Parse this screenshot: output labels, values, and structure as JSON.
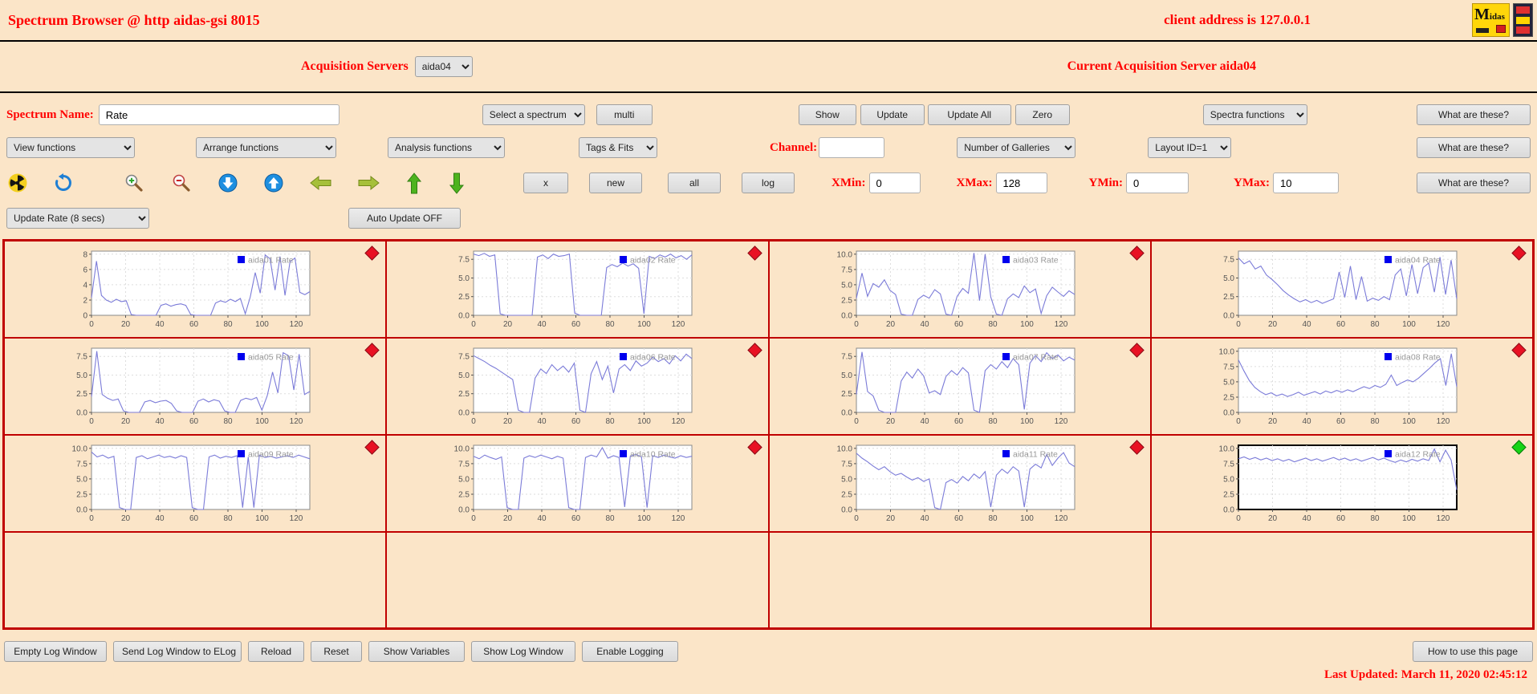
{
  "header": {
    "title": "Spectrum Browser @ http aidas-gsi 8015",
    "client_address": "client address is 127.0.0.1",
    "midas_logo_m": "M",
    "midas_logo_rest": "idas"
  },
  "server_bar": {
    "label": "Acquisition Servers",
    "server_select": "aida04",
    "current_server": "Current Acquisition Server aida04"
  },
  "spectrum_bar": {
    "name_label": "Spectrum Name:",
    "name_value": "Rate",
    "spectrum_select": "Select a spectrum",
    "multi_button": "multi",
    "show_button": "Show",
    "update_button": "Update",
    "update_all_button": "Update All",
    "zero_button": "Zero",
    "spectra_functions_select": "Spectra functions",
    "help_button": "What are these?"
  },
  "functions_bar": {
    "view_select": "View functions",
    "arrange_select": "Arrange functions",
    "analysis_select": "Analysis functions",
    "tags_select": "Tags & Fits",
    "channel_label": "Channel:",
    "channel_value": "",
    "galleries_select": "Number of Galleries",
    "layout_select": "Layout ID=1",
    "help_button": "What are these?"
  },
  "zoom_bar": {
    "icons": [
      "radiation-icon",
      "refresh-icon",
      "zoom-in-icon",
      "zoom-out-icon",
      "scale-down-icon",
      "scale-up-icon",
      "pan-left-icon",
      "pan-right-icon",
      "pan-up-icon",
      "pan-down-icon"
    ],
    "x_button": "x",
    "new_button": "new",
    "all_button": "all",
    "log_button": "log",
    "xmin_label": "XMin:",
    "xmin_value": "0",
    "xmax_label": "XMax:",
    "xmax_value": "128",
    "ymin_label": "YMin:",
    "ymin_value": "0",
    "ymax_label": "YMax:",
    "ymax_value": "10",
    "help_button": "What are these?"
  },
  "update_bar": {
    "rate_select": "Update Rate (8 secs)",
    "auto_update_button": "Auto Update OFF"
  },
  "footer": {
    "buttons": [
      "Empty Log Window",
      "Send Log Window to ELog",
      "Reload",
      "Reset",
      "Show Variables",
      "Show Log Window",
      "Enable Logging"
    ],
    "help_button": "How to use this page",
    "last_updated": "Last Updated: March 11, 2020 02:45:12"
  },
  "chart_data": {
    "type": "line",
    "x_range": [
      0,
      128
    ],
    "xticks": [
      0,
      20,
      40,
      60,
      80,
      100,
      120
    ],
    "grid": true,
    "legend_position": "top-right",
    "line_color": "#7b7bd8",
    "legend_marker_color": "#0000ee",
    "empty_cells": 4,
    "panels": [
      {
        "name": "aida01 Rate",
        "marker": "red",
        "selected": false,
        "ymax": 8.4,
        "yticks": [
          0,
          2,
          4,
          6,
          8
        ],
        "ytick_labels": [
          "0",
          "2",
          "4",
          "6",
          "8"
        ],
        "values": [
          2.3,
          7.1,
          2.6,
          2.0,
          1.7,
          2.1,
          1.8,
          1.9,
          0.1,
          0,
          0,
          0,
          0,
          0,
          1.3,
          1.5,
          1.2,
          1.4,
          1.5,
          1.3,
          0.1,
          0,
          0,
          0,
          0,
          1.6,
          1.9,
          1.7,
          2.1,
          1.8,
          2.2,
          0.2,
          2.4,
          5.6,
          2.9,
          7.9,
          7.4,
          3.3,
          7.7,
          2.6,
          7.0,
          7.5,
          3.0,
          2.7,
          3.1
        ]
      },
      {
        "name": "aida02 Rate",
        "marker": "red",
        "selected": false,
        "ymax": 8.6,
        "yticks": [
          0,
          2.5,
          5,
          7.5
        ],
        "ytick_labels": [
          "0.0",
          "2.5",
          "5.0",
          "7.5"
        ],
        "values": [
          8.2,
          8.0,
          8.3,
          7.9,
          8.1,
          0.2,
          0,
          0,
          0,
          0,
          0,
          0,
          7.8,
          8.1,
          7.6,
          8.2,
          7.9,
          8.0,
          8.2,
          0.3,
          0,
          0,
          0,
          0,
          0,
          6.4,
          6.8,
          6.5,
          7.0,
          6.6,
          6.9,
          6.3,
          0.2,
          7.9,
          7.6,
          8.1,
          7.8,
          8.2,
          7.7,
          8.0,
          7.5,
          8.1
        ]
      },
      {
        "name": "aida03 Rate",
        "marker": "red",
        "selected": false,
        "ymax": 10.5,
        "yticks": [
          0,
          2.5,
          5,
          7.5,
          10
        ],
        "ytick_labels": [
          "0.0",
          "2.5",
          "5.0",
          "7.5",
          "10.0"
        ],
        "values": [
          2.8,
          6.9,
          3.1,
          5.2,
          4.6,
          5.8,
          4.1,
          3.4,
          0.2,
          0,
          0,
          2.6,
          3.3,
          2.8,
          4.2,
          3.5,
          0.2,
          0,
          3.1,
          4.4,
          3.6,
          10.2,
          2.4,
          10.0,
          3.0,
          0.2,
          0,
          2.7,
          3.5,
          2.9,
          4.8,
          3.7,
          4.3,
          0.3,
          3.2,
          4.6,
          3.8,
          3.1,
          4.0,
          3.4
        ]
      },
      {
        "name": "aida04 Rate",
        "marker": "red",
        "selected": false,
        "ymax": 8.6,
        "yticks": [
          0,
          2.5,
          5,
          7.5
        ],
        "ytick_labels": [
          "0.0",
          "2.5",
          "5.0",
          "7.5"
        ],
        "values": [
          7.7,
          6.9,
          7.3,
          6.2,
          6.6,
          5.4,
          4.8,
          4.1,
          3.3,
          2.7,
          2.2,
          1.8,
          2.1,
          1.7,
          2.0,
          1.6,
          1.9,
          2.2,
          5.8,
          2.4,
          6.6,
          2.1,
          5.2,
          1.9,
          2.3,
          2.0,
          2.5,
          2.1,
          5.4,
          6.2,
          2.6,
          6.8,
          2.9,
          6.4,
          7.0,
          3.1,
          7.8,
          2.8,
          7.4,
          2.2
        ]
      },
      {
        "name": "aida05 Rate",
        "marker": "red",
        "selected": false,
        "ymax": 8.6,
        "yticks": [
          0,
          2.5,
          5,
          7.5
        ],
        "ytick_labels": [
          "0.0",
          "2.5",
          "5.0",
          "7.5"
        ],
        "values": [
          2.1,
          8.2,
          2.4,
          1.9,
          1.6,
          1.8,
          0.2,
          0,
          0,
          0,
          1.4,
          1.6,
          1.3,
          1.5,
          1.6,
          1.2,
          0.2,
          0,
          0,
          0,
          1.5,
          1.8,
          1.4,
          1.7,
          1.5,
          0.2,
          0,
          0,
          1.6,
          1.9,
          1.7,
          2.0,
          0.3,
          2.2,
          5.4,
          2.6,
          8.0,
          7.6,
          3.0,
          7.8,
          2.4,
          2.8
        ]
      },
      {
        "name": "aida06 Rate",
        "marker": "red",
        "selected": false,
        "ymax": 8.6,
        "yticks": [
          0,
          2.5,
          5,
          7.5
        ],
        "ytick_labels": [
          "0.0",
          "2.5",
          "5.0",
          "7.5"
        ],
        "values": [
          7.6,
          7.2,
          6.8,
          6.3,
          5.9,
          5.4,
          4.9,
          4.4,
          0.3,
          0,
          0,
          4.6,
          5.8,
          5.2,
          6.4,
          5.6,
          6.2,
          5.4,
          6.6,
          0.3,
          0,
          5.2,
          6.8,
          4.4,
          6.2,
          2.6,
          5.8,
          6.4,
          5.6,
          6.9,
          6.2,
          6.6,
          7.4,
          6.8,
          7.2,
          6.5,
          7.6,
          6.9,
          7.8,
          7.2
        ]
      },
      {
        "name": "aida07 Rate",
        "marker": "red",
        "selected": false,
        "ymax": 8.6,
        "yticks": [
          0,
          2.5,
          5,
          7.5
        ],
        "ytick_labels": [
          "0.0",
          "2.5",
          "5.0",
          "7.5"
        ],
        "values": [
          2.4,
          8.1,
          2.8,
          2.2,
          0.3,
          0,
          0,
          0,
          4.2,
          5.4,
          4.6,
          5.8,
          4.9,
          2.6,
          2.9,
          2.4,
          4.8,
          5.6,
          5.0,
          6.0,
          5.3,
          0.3,
          0,
          5.6,
          6.4,
          5.8,
          6.8,
          6.0,
          7.2,
          6.4,
          0.4,
          6.6,
          7.6,
          6.8,
          8.0,
          7.2,
          7.7,
          6.9,
          7.4,
          7.0
        ]
      },
      {
        "name": "aida08 Rate",
        "marker": "red",
        "selected": false,
        "ymax": 10.5,
        "yticks": [
          0,
          2.5,
          5,
          7.5,
          10
        ],
        "ytick_labels": [
          "0.0",
          "2.5",
          "5.0",
          "7.5",
          "10.0"
        ],
        "values": [
          8.6,
          6.8,
          5.2,
          4.1,
          3.4,
          2.9,
          3.2,
          2.7,
          3.0,
          2.6,
          2.9,
          3.3,
          2.8,
          3.1,
          3.4,
          3.0,
          3.5,
          3.2,
          3.6,
          3.3,
          3.7,
          3.4,
          3.8,
          4.2,
          3.9,
          4.4,
          4.1,
          4.6,
          6.1,
          4.4,
          4.9,
          5.3,
          5.0,
          5.6,
          6.4,
          7.2,
          8.1,
          8.8,
          4.4,
          9.6,
          4.2
        ]
      },
      {
        "name": "aida09 Rate",
        "marker": "red",
        "selected": false,
        "ymax": 10.5,
        "yticks": [
          0,
          2.5,
          5,
          7.5,
          10
        ],
        "ytick_labels": [
          "0.0",
          "2.5",
          "5.0",
          "7.5",
          "10.0"
        ],
        "values": [
          9.4,
          8.6,
          8.9,
          8.4,
          8.7,
          0.3,
          0,
          0,
          8.5,
          8.8,
          8.3,
          8.6,
          8.9,
          8.5,
          8.7,
          8.4,
          8.8,
          8.5,
          0.3,
          0,
          0,
          8.6,
          8.9,
          8.4,
          8.7,
          8.5,
          8.8,
          0.3,
          8.6,
          0.3,
          8.9,
          8.5,
          8.7,
          8.4,
          8.6,
          8.8,
          8.5,
          8.9,
          8.6,
          8.3
        ]
      },
      {
        "name": "aida10 Rate",
        "marker": "red",
        "selected": false,
        "ymax": 10.5,
        "yticks": [
          0,
          2.5,
          5,
          7.5,
          10
        ],
        "ytick_labels": [
          "0.0",
          "2.5",
          "5.0",
          "7.5",
          "10.0"
        ],
        "values": [
          8.7,
          8.3,
          8.9,
          8.5,
          8.2,
          8.6,
          0.3,
          0,
          0,
          8.4,
          8.8,
          8.5,
          8.9,
          8.6,
          8.3,
          8.7,
          8.4,
          0.3,
          0,
          0,
          8.5,
          8.9,
          8.6,
          10.1,
          8.4,
          8.8,
          8.5,
          0.4,
          8.7,
          9.0,
          8.6,
          0.3,
          8.8,
          8.5,
          8.9,
          8.6,
          8.4,
          8.8,
          8.5,
          8.7
        ]
      },
      {
        "name": "aida11 Rate",
        "marker": "red",
        "selected": false,
        "ymax": 10.5,
        "yticks": [
          0,
          2.5,
          5,
          7.5,
          10
        ],
        "ytick_labels": [
          "0.0",
          "2.5",
          "5.0",
          "7.5",
          "10.0"
        ],
        "values": [
          9.2,
          8.4,
          7.8,
          7.1,
          6.5,
          7.0,
          6.2,
          5.6,
          5.9,
          5.3,
          4.8,
          5.2,
          4.6,
          5.0,
          0.3,
          0,
          4.4,
          4.9,
          4.3,
          5.4,
          4.7,
          5.8,
          5.1,
          6.2,
          0.4,
          5.6,
          6.6,
          5.9,
          7.0,
          6.3,
          0.4,
          6.6,
          7.4,
          6.8,
          9.0,
          7.2,
          8.4,
          9.3,
          7.6,
          7.0
        ]
      },
      {
        "name": "aida12 Rate",
        "marker": "green",
        "selected": true,
        "ymax": 10.5,
        "yticks": [
          0,
          2.5,
          5,
          7.5,
          10
        ],
        "ytick_labels": [
          "0.0",
          "2.5",
          "5.0",
          "7.5",
          "10.0"
        ],
        "values": [
          8.3,
          8.6,
          8.2,
          8.5,
          8.1,
          8.4,
          8.0,
          8.3,
          7.9,
          8.2,
          7.8,
          8.1,
          8.4,
          8.0,
          8.3,
          7.9,
          8.2,
          8.5,
          8.1,
          8.4,
          8.0,
          8.3,
          7.9,
          8.2,
          8.5,
          8.1,
          8.4,
          8.0,
          7.7,
          8.1,
          7.8,
          8.2,
          7.9,
          8.3,
          8.0,
          9.9,
          7.8,
          9.7,
          8.1,
          3.2
        ]
      }
    ]
  }
}
